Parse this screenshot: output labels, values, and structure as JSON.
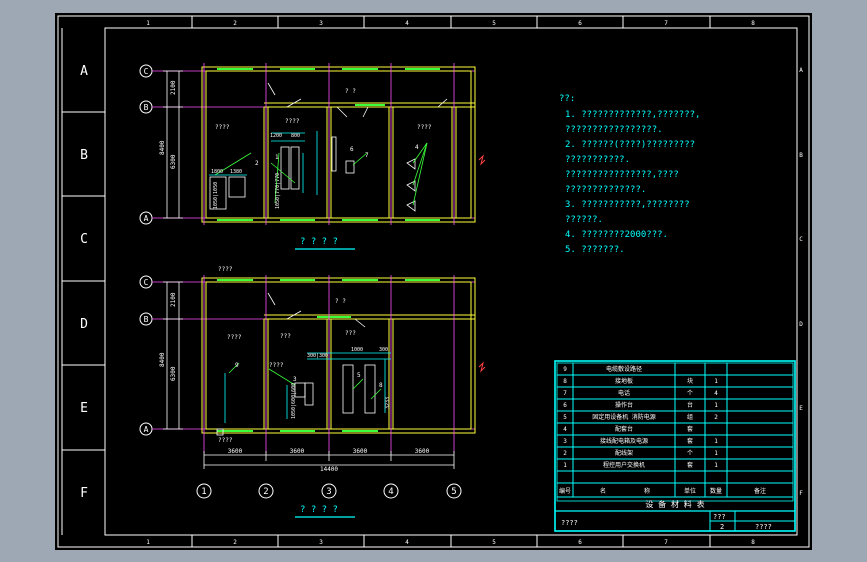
{
  "frame": {
    "col_numbers": [
      "1",
      "2",
      "3",
      "4",
      "5",
      "6",
      "7",
      "8"
    ],
    "row_letters": [
      "A",
      "B",
      "C",
      "D",
      "E",
      "F"
    ]
  },
  "plan_top": {
    "title": "? ? ? ?",
    "axis_labels": [
      "C",
      "B",
      "A"
    ],
    "dims": {
      "upper": "2100",
      "total": "8400",
      "lower": "6300"
    },
    "room_labels": [
      "? ?",
      "????",
      "????",
      "????"
    ],
    "item_numbers": [
      "1",
      "2",
      "6",
      "7",
      "4"
    ],
    "small_dims": [
      "1200",
      "800",
      "1800",
      "1380",
      "1050|1050",
      "1050|770|770"
    ]
  },
  "plan_bottom": {
    "title": "? ? ? ?",
    "axis_labels": [
      "C",
      "B",
      "A"
    ],
    "dims": {
      "upper": "2100",
      "total": "8400",
      "lower": "6300"
    },
    "top_note": "????",
    "bottom_note": "????",
    "room_labels": [
      "? ?",
      "????",
      "???",
      "???",
      "????"
    ],
    "item_numbers": [
      "9",
      "3",
      "5",
      "8"
    ],
    "small_dims": [
      "300|300",
      "1000",
      "300",
      "1050|600|600",
      "3233"
    ],
    "bay_dims": [
      "3600",
      "3600",
      "3600",
      "3600"
    ],
    "overall_dim": "14400",
    "grid_numbers": [
      "1",
      "2",
      "3",
      "4",
      "5"
    ]
  },
  "notes": {
    "heading": "??:",
    "lines": [
      "1. ?????????????,???????,",
      "   ?????????????????.",
      "2. ??????(????)?????????",
      "   ???????????.",
      "   ????????????????,????",
      "   ??????????????.",
      "3. ???????????,????????",
      "   ??????.",
      "4. ????????2000???.",
      "5. ???????."
    ]
  },
  "table": {
    "title": "设 备 材 料 表",
    "header": [
      "编号",
      "名",
      "称",
      "单位",
      "数量",
      "备注"
    ],
    "rows": [
      [
        "9",
        "电缆敷设路径",
        "",
        "",
        ""
      ],
      [
        "8",
        "接地板",
        "",
        "块",
        "1"
      ],
      [
        "7",
        "电话",
        "",
        "个",
        "4"
      ],
      [
        "6",
        "操作台",
        "",
        "台",
        "1"
      ],
      [
        "5",
        "固定用设备机 消防电源",
        "",
        "组",
        "2"
      ],
      [
        "4",
        "配套台",
        "",
        "套",
        ""
      ],
      [
        "3",
        "接线配电箱及电源",
        "",
        "套",
        "1"
      ],
      [
        "2",
        "配线架",
        "",
        "个",
        "1"
      ],
      [
        "1",
        "程控用户交换机",
        "",
        "套",
        "1"
      ]
    ]
  },
  "title_block": {
    "name": "????",
    "code1": "???",
    "code2": "2",
    "code3": "????"
  }
}
